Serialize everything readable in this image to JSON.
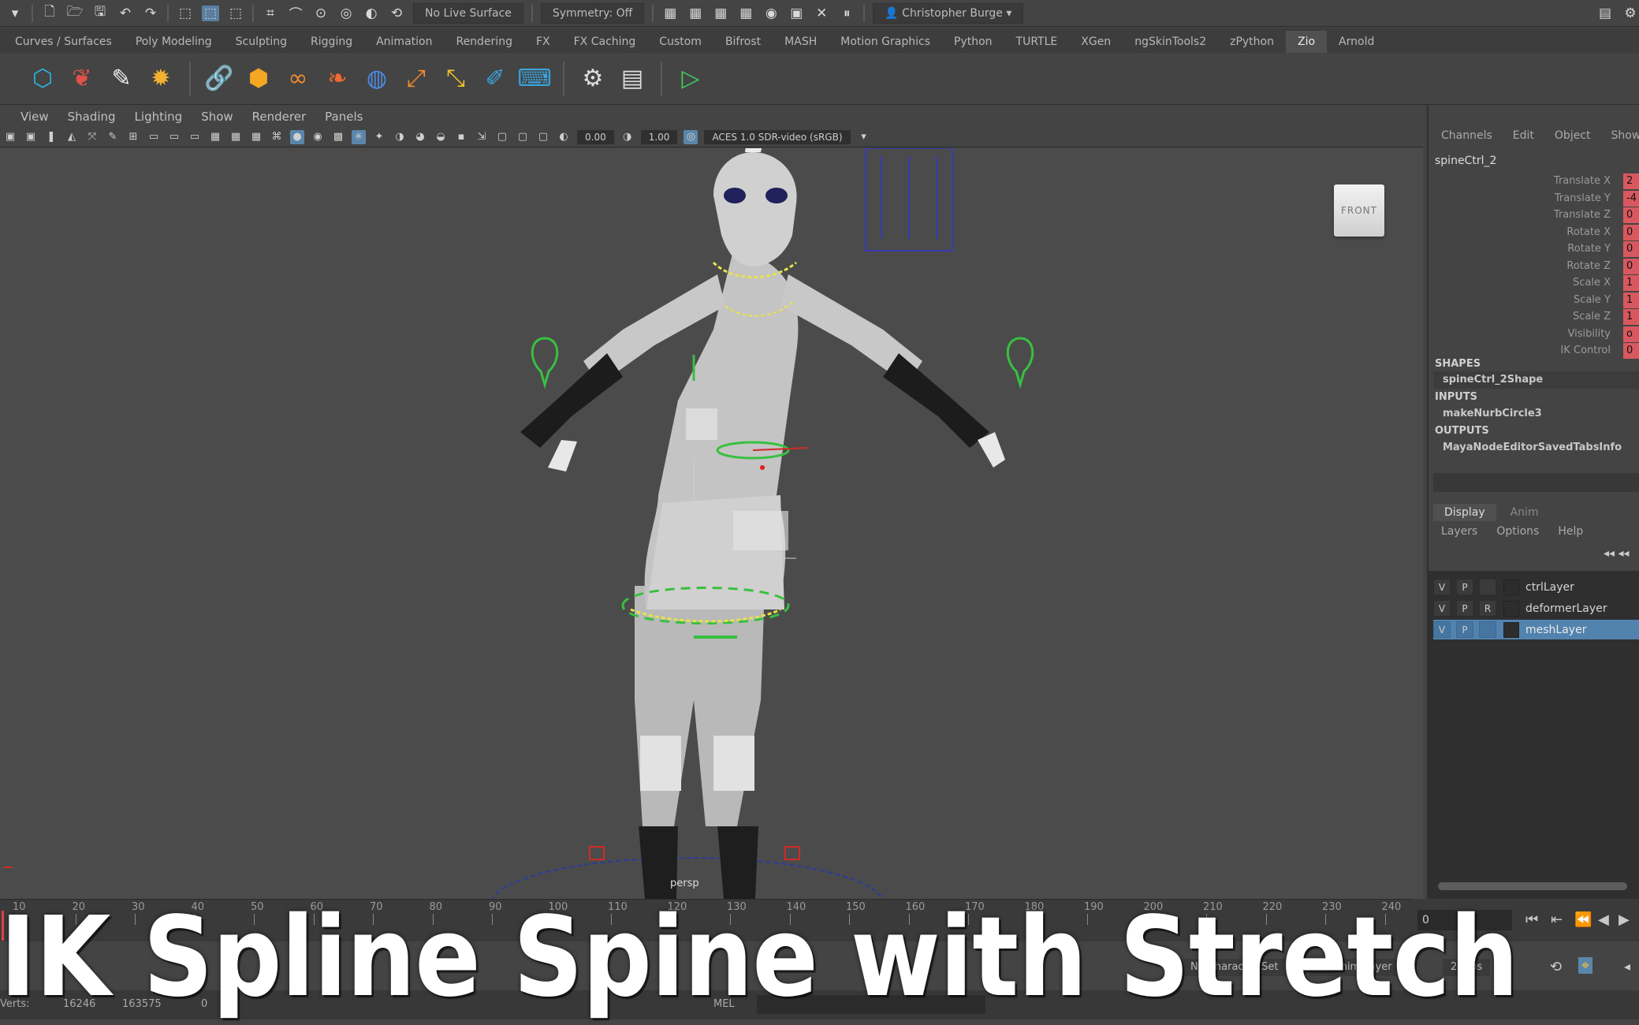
{
  "statusline": {
    "live_surface": "No Live Surface",
    "symmetry": "Symmetry: Off",
    "user": "Christopher Burge"
  },
  "shelf_tabs": [
    "Curves / Surfaces",
    "Poly Modeling",
    "Sculpting",
    "Rigging",
    "Animation",
    "Rendering",
    "FX",
    "FX Caching",
    "Custom",
    "Bifrost",
    "MASH",
    "Motion Graphics",
    "Python",
    "TURTLE",
    "XGen",
    "ngSkinTools2",
    "zPython",
    "Zio",
    "Arnold"
  ],
  "shelf_active": "Zio",
  "viewport": {
    "menu": [
      "View",
      "Shading",
      "Lighting",
      "Show",
      "Renderer",
      "Panels"
    ],
    "exposure": "0.00",
    "gamma": "1.00",
    "colorspace": "ACES 1.0 SDR-video (sRGB)",
    "viewcube_label": "FRONT",
    "camera_label": "persp"
  },
  "channel_box": {
    "menu": [
      "Channels",
      "Edit",
      "Object",
      "Show"
    ],
    "object": "spineCtrl_2",
    "attributes": [
      {
        "label": "Translate X",
        "value": "2"
      },
      {
        "label": "Translate Y",
        "value": "-4"
      },
      {
        "label": "Translate Z",
        "value": "0"
      },
      {
        "label": "Rotate X",
        "value": "0"
      },
      {
        "label": "Rotate Y",
        "value": "0"
      },
      {
        "label": "Rotate Z",
        "value": "0"
      },
      {
        "label": "Scale X",
        "value": "1"
      },
      {
        "label": "Scale Y",
        "value": "1"
      },
      {
        "label": "Scale Z",
        "value": "1"
      },
      {
        "label": "Visibility",
        "value": "o"
      },
      {
        "label": "IK Control",
        "value": "0"
      }
    ],
    "shapes_header": "SHAPES",
    "shape": "spineCtrl_2Shape",
    "inputs_header": "INPUTS",
    "input": "makeNurbCircle3",
    "outputs_header": "OUTPUTS",
    "output": "MayaNodeEditorSavedTabsInfo"
  },
  "layer_editor": {
    "tabs": [
      "Display",
      "Anim"
    ],
    "menu": [
      "Layers",
      "Options",
      "Help"
    ],
    "layers": [
      {
        "v": "V",
        "p": "P",
        "r": "",
        "name": "ctrlLayer",
        "selected": false
      },
      {
        "v": "V",
        "p": "P",
        "r": "R",
        "name": "deformerLayer",
        "selected": false
      },
      {
        "v": "V",
        "p": "P",
        "r": "",
        "name": "meshLayer",
        "selected": true
      }
    ]
  },
  "timeline": {
    "ticks": [
      "10",
      "20",
      "30",
      "40",
      "50",
      "60",
      "70",
      "80",
      "90",
      "100",
      "110",
      "120",
      "130",
      "140",
      "150",
      "160",
      "170",
      "180",
      "190",
      "200",
      "210",
      "220",
      "230",
      "240"
    ],
    "current_frame": "0"
  },
  "range": {
    "char_set": "No Character Set",
    "anim_layer": "No Anim Layer",
    "fps": "24 fps"
  },
  "helpline": {
    "mode": "MEL",
    "verts": "Verts:",
    "v1": "16246",
    "v2": "163575",
    "v3": "0"
  },
  "caption": "IK Spline Spine with Stretch",
  "colors": {
    "background": "#444444",
    "viewport": "#4b4b4b",
    "selection": "#5283ae",
    "keyed_attr": "#d8585f",
    "shelf_accent": "#2aa8d8"
  }
}
